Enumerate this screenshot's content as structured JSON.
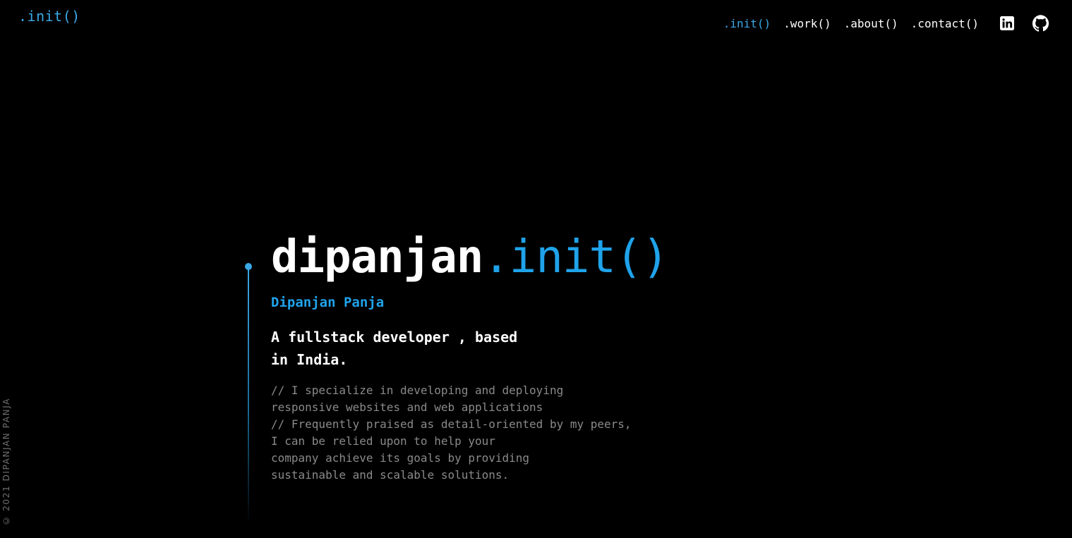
{
  "header": {
    "logo": ".init()",
    "nav": [
      {
        "label": ".init()",
        "active": true
      },
      {
        "label": ".work()",
        "active": false
      },
      {
        "label": ".about()",
        "active": false
      },
      {
        "label": ".contact()",
        "active": false
      }
    ],
    "social_icons": [
      "linkedin-icon",
      "github-icon"
    ]
  },
  "hero": {
    "title_name": "dipanjan",
    "title_accent": ".init()",
    "subtitle": "Dipanjan Panja",
    "tagline": [
      "A fullstack developer , based",
      "in India."
    ],
    "description": [
      "// I specialize in developing and deploying",
      "responsive websites and web applications",
      "// Frequently praised as detail-oriented by my peers,",
      "I can be relied upon to help your",
      "company achieve its goals by providing",
      "sustainable and scalable solutions."
    ]
  },
  "footer": {
    "copyright": "© 2021 DIPANJAN PANJA"
  },
  "colors": {
    "background": "#000000",
    "accent": "#1fa3ea",
    "text": "#ffffff",
    "muted": "#8a8a8a"
  }
}
